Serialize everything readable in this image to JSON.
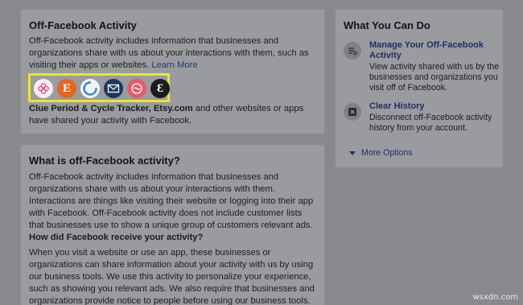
{
  "off_facebook_card": {
    "title": "Off-Facebook Activity",
    "description": "Off-Facebook activity includes information that businesses and organizations share with us about your interactions with them, such as visiting their apps or websites.",
    "learn_more": "Learn More",
    "apps_bold": "Clue Period & Cycle Tracker, Etsy.com",
    "apps_rest": " and other websites or apps have shared your activity with Facebook.",
    "app_icons": [
      {
        "name": "clue-app",
        "glyph": "✿",
        "color": "#f4f4f4"
      },
      {
        "name": "etsy-app",
        "glyph": "E",
        "color": "#e86a22"
      },
      {
        "name": "ring-app",
        "glyph": "",
        "color": "#f4f4f4"
      },
      {
        "name": "mail-app",
        "glyph": "✉",
        "color": "#163a63"
      },
      {
        "name": "pink-app",
        "glyph": "❃",
        "color": "#e65b6b"
      },
      {
        "name": "e-app",
        "glyph": "Ɛ",
        "color": "#1b1b1b"
      }
    ]
  },
  "what_is_card": {
    "title": "What is off-Facebook activity?",
    "paragraph1": "Off-Facebook activity includes information that businesses and organizations share with us about your interactions with them. Interactions are things like visiting their website or logging into their app with Facebook. Off-Facebook activity does not include customer lists that businesses use to show a unique group of customers relevant ads.",
    "subheading": "How did Facebook receive your activity?",
    "paragraph2": "When you visit a website or use an app, these businesses or organizations can share information about your activity with us by using our business tools. We use this activity to personalize your experience, such as showing you relevant ads. We also require that businesses and organizations provide notice to people before using our business tools."
  },
  "side_card": {
    "title": "What You Can Do",
    "actions": [
      {
        "icon": "manage-list-icon",
        "label": "Manage Your Off-Facebook Activity",
        "description": "View activity shared with us by the businesses and organizations you visit off of Facebook."
      },
      {
        "icon": "clear-x-icon",
        "label": "Clear History",
        "description": "Disconnect off-Facebook activity history from your account."
      }
    ],
    "more_options": "More Options"
  },
  "watermark": "wsxdn.com"
}
